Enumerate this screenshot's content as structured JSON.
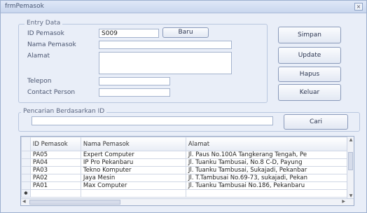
{
  "window": {
    "title": "frmPemasok",
    "close_glyph": "×"
  },
  "entry": {
    "legend": "Entry Data",
    "id_label": "ID Pemasok",
    "id_value": "S009",
    "baru_label": "Baru",
    "nama_label": "Nama Pemasok",
    "alamat_label": "Alamat",
    "telepon_label": "Telepon",
    "contact_label": "Contact Person"
  },
  "actions": {
    "simpan": "Simpan",
    "update": "Update",
    "hapus": "Hapus",
    "keluar": "Keluar"
  },
  "search": {
    "legend": "Pencarian Berdasarkan ID",
    "cari_label": "Cari"
  },
  "grid": {
    "columns": [
      "ID Pemasok",
      "Nama Pemasok",
      "Alamat"
    ],
    "rows": [
      [
        "PA05",
        "Expert Computer",
        "Jl. Paus No.100A Tangkerang Tengah, Pe"
      ],
      [
        "PA04",
        "IP Pro Pekanbaru",
        "Jl. Tuanku Tambusai, No.8 C-D, Payung"
      ],
      [
        "PA03",
        "Tekno Komputer",
        "Jl. Tuanku Tambusai, Sukajadi, Pekanbar"
      ],
      [
        "PA02",
        "Jaya Mesin",
        "Jl. T.Tambusai No.69-73, sukajadi, Pekan"
      ],
      [
        "PA01",
        "Max Computer",
        "Jl. Tuanku Tambusai No.186, Pekanbaru"
      ]
    ],
    "new_row_marker": "✱"
  }
}
